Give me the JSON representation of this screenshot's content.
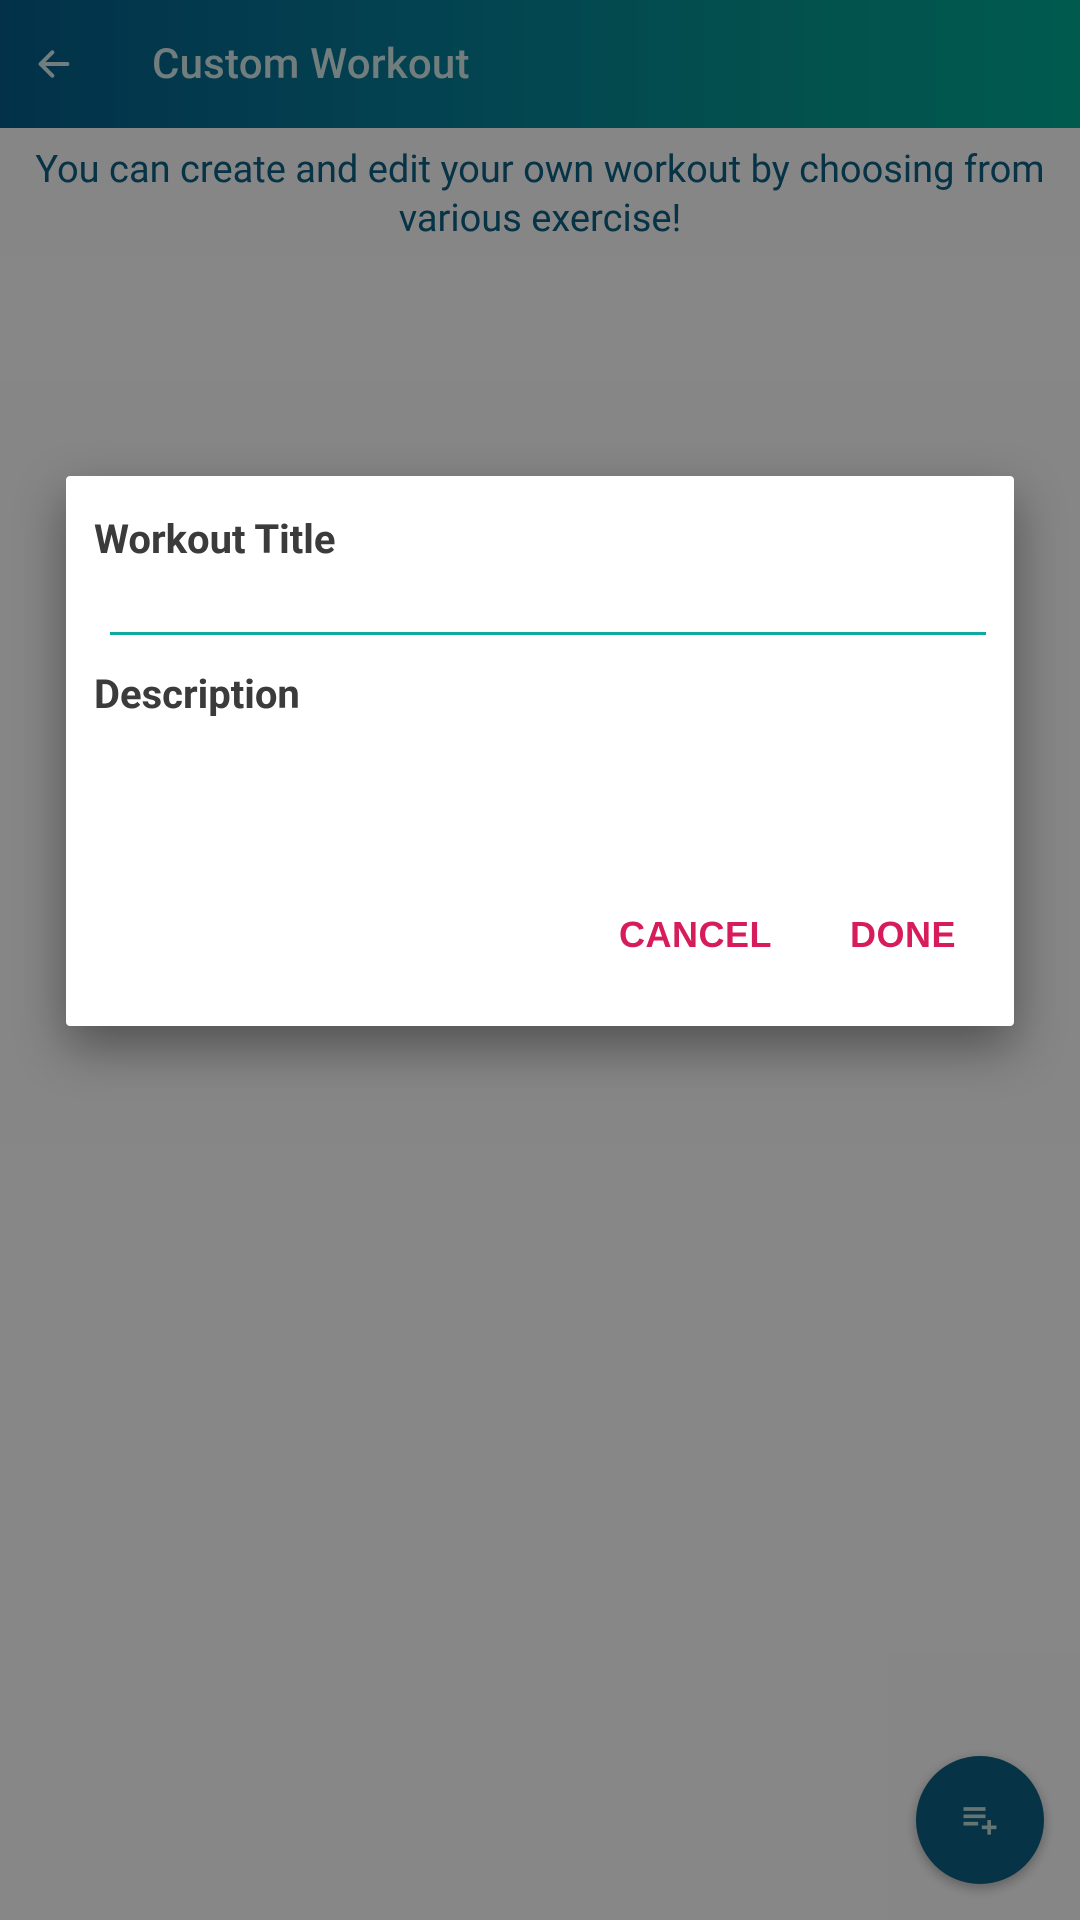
{
  "appbar": {
    "title": "Custom Workout"
  },
  "page": {
    "intro_text": "You can create and edit your own workout by choosing from various exercise!"
  },
  "dialog": {
    "title_label": "Workout Title",
    "title_value": "",
    "description_label": "Description",
    "description_value": "",
    "cancel_label": "CANCEL",
    "done_label": "DONE"
  }
}
